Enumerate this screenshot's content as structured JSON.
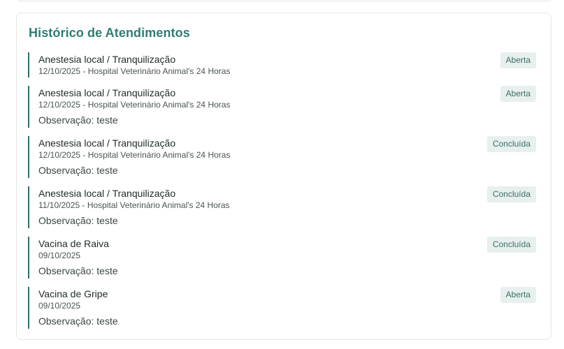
{
  "history": {
    "title": "Histórico de Atendimentos",
    "entries": [
      {
        "title": "Anestesia local / Tranquilização",
        "meta": "12/10/2025 - Hospital Veterinário Animal's 24 Horas",
        "note": "",
        "status": "Aberta"
      },
      {
        "title": "Anestesia local / Tranquilização",
        "meta": "12/10/2025 - Hospital Veterinário Animal's 24 Horas",
        "note": "Observação: teste",
        "status": "Aberta"
      },
      {
        "title": "Anestesia local / Tranquilização",
        "meta": "12/10/2025 - Hospital Veterinário Animal's 24 Horas",
        "note": "Observação: teste",
        "status": "Concluída"
      },
      {
        "title": "Anestesia local / Tranquilização",
        "meta": "11/10/2025 - Hospital Veterinário Animal's 24 Horas",
        "note": "Observação: teste",
        "status": "Concluída"
      },
      {
        "title": "Vacina de Raiva",
        "meta": "09/10/2025",
        "note": "Observação: teste",
        "status": "Concluída"
      },
      {
        "title": "Vacina de Gripe",
        "meta": "09/10/2025",
        "note": "Observação: teste",
        "status": "Aberta"
      }
    ]
  },
  "colors": {
    "accent": "#2e7d72",
    "entry_border": "#2f6f67",
    "badge_bg": "#e7f0ee",
    "badge_text": "#3d6d66"
  }
}
